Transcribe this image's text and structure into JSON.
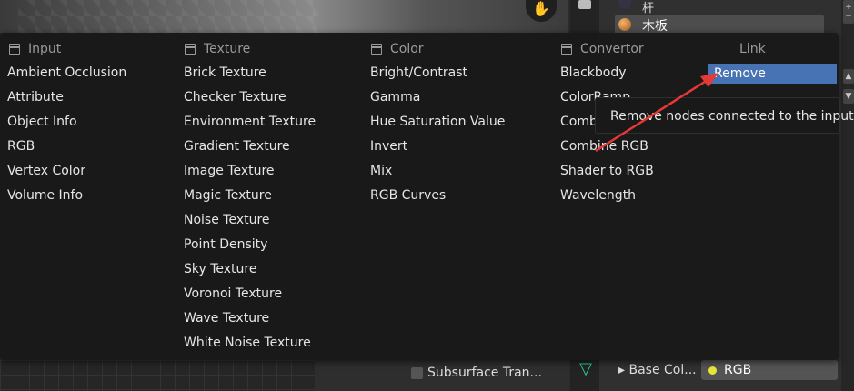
{
  "background": {
    "subsurface_label": "Subsurface Tran...",
    "materials": [
      "杆",
      "木板"
    ],
    "base_color_label": "Base Col...",
    "base_color_value": "RGB"
  },
  "menu": {
    "columns": [
      {
        "header": "Input",
        "items": [
          "Ambient Occlusion",
          "Attribute",
          "Object Info",
          "RGB",
          "Vertex Color",
          "Volume Info"
        ]
      },
      {
        "header": "Texture",
        "items": [
          "Brick Texture",
          "Checker Texture",
          "Environment Texture",
          "Gradient Texture",
          "Image Texture",
          "Magic Texture",
          "Noise Texture",
          "Point Density",
          "Sky Texture",
          "Voronoi Texture",
          "Wave Texture",
          "White Noise Texture"
        ]
      },
      {
        "header": "Color",
        "items": [
          "Bright/Contrast",
          "Gamma",
          "Hue Saturation Value",
          "Invert",
          "Mix",
          "RGB Curves"
        ]
      },
      {
        "header": "Convertor",
        "items": [
          "Blackbody",
          "ColorRamp",
          "Combi",
          "Combine RGB",
          "Shader to RGB",
          "Wavelength"
        ]
      },
      {
        "header": "Link",
        "items": [
          "Remove"
        ]
      }
    ],
    "highlighted": "Remove",
    "tooltip": "Remove nodes connected to the input."
  },
  "colors": {
    "menu_bg": "#181818",
    "highlight": "#4772b3",
    "arrow": "#e53935"
  },
  "icons": [
    "hand-icon",
    "node-header-icon",
    "arrow-annotation"
  ]
}
